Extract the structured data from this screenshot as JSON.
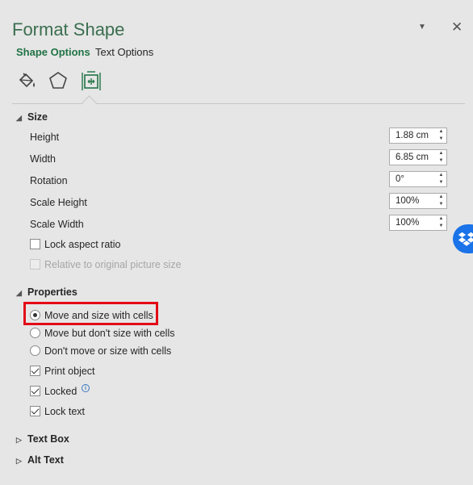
{
  "pane": {
    "title": "Format Shape",
    "menu_icon": "caret-down-icon",
    "close_icon": "close-icon",
    "tabs": [
      {
        "label": "Shape Options",
        "active": true
      },
      {
        "label": "Text Options",
        "active": false
      }
    ],
    "icon_tabs": [
      "fill-line-icon",
      "effects-pentagon-icon",
      "size-properties-icon"
    ],
    "accent_color": "#217346"
  },
  "size": {
    "header": "Size",
    "fields": [
      {
        "label": "Height",
        "value": "1.88 cm"
      },
      {
        "label": "Width",
        "value": "6.85 cm"
      },
      {
        "label": "Rotation",
        "value": "0°"
      },
      {
        "label": "Scale Height",
        "value": "100%"
      },
      {
        "label": "Scale Width",
        "value": "100%"
      }
    ],
    "lock_aspect": {
      "label": "Lock aspect ratio",
      "checked": false
    },
    "relative_original": {
      "label": "Relative to original picture size",
      "checked": false,
      "disabled": true
    }
  },
  "properties": {
    "header": "Properties",
    "radios": [
      {
        "label": "Move and size with cells",
        "selected": true
      },
      {
        "label": "Move but don't size with cells",
        "selected": false
      },
      {
        "label": "Don't move or size with cells",
        "selected": false
      }
    ],
    "print_object": {
      "label": "Print object",
      "checked": true
    },
    "locked": {
      "label": "Locked",
      "checked": true
    },
    "lock_text": {
      "label": "Lock text",
      "checked": true
    },
    "highlight_color": "#e30b17"
  },
  "collapsed_sections": [
    {
      "label": "Text Box"
    },
    {
      "label": "Alt Text"
    }
  ],
  "overlay": {
    "icon": "dropbox-icon",
    "color": "#1a73e8"
  }
}
